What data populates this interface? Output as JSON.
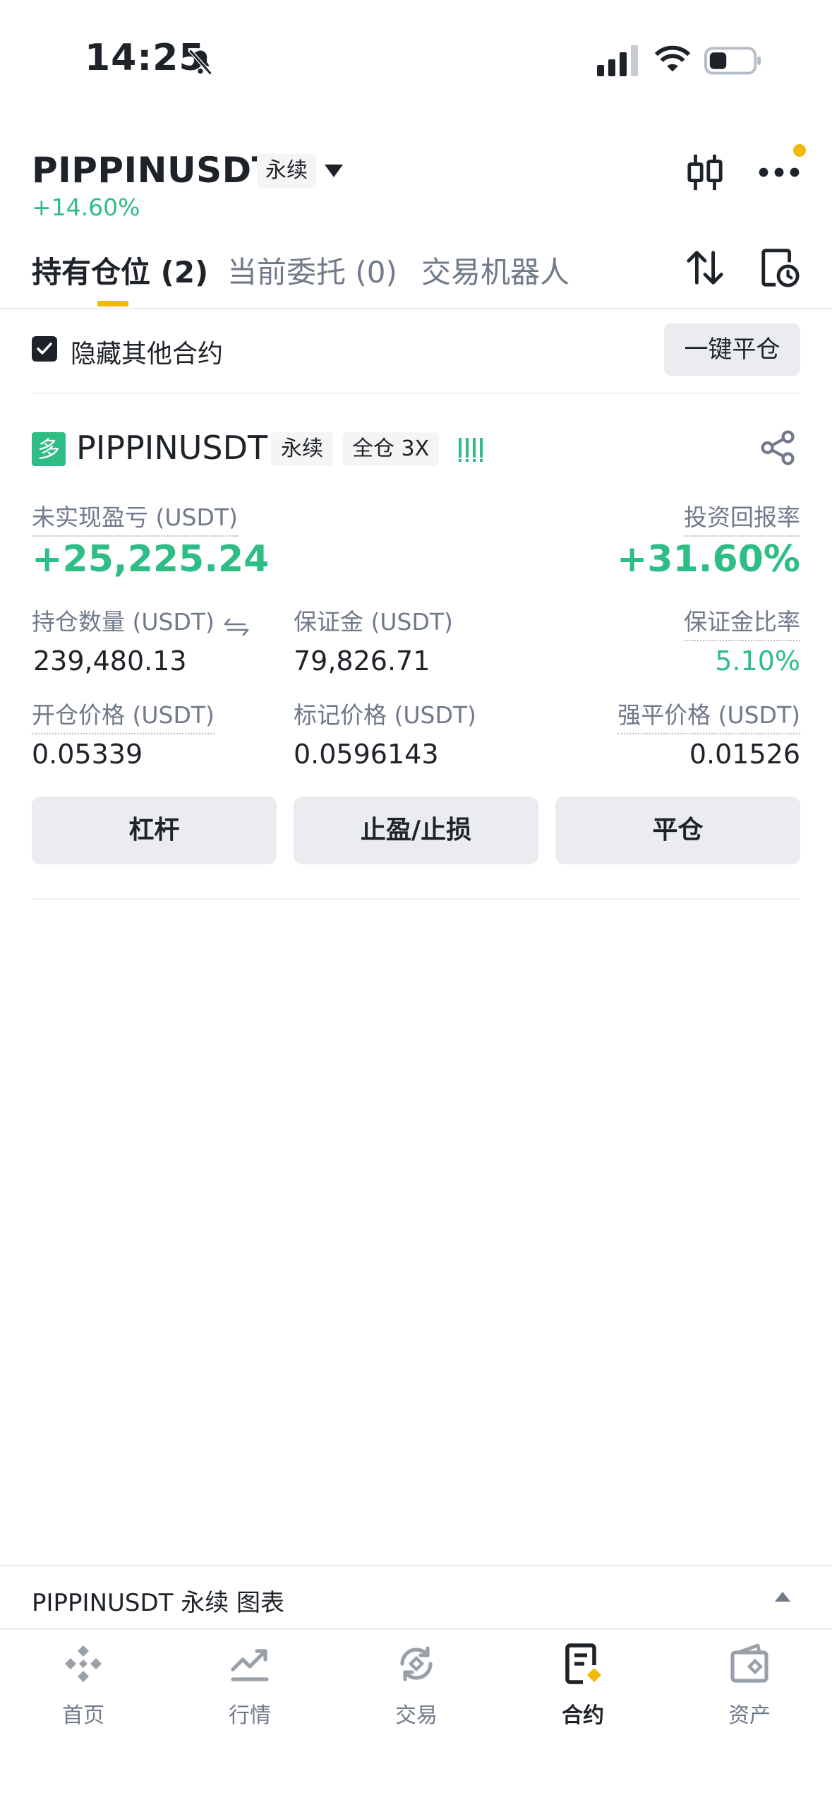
{
  "status_bar": {
    "time": "14:25"
  },
  "header": {
    "symbol": "PIPPINUSDT",
    "contract_type": "永续",
    "change": "+14.60%"
  },
  "tabs": [
    {
      "label": "持有仓位 (2)",
      "active": true
    },
    {
      "label": "当前委托 (0)",
      "active": false
    },
    {
      "label": "交易机器人",
      "active": false
    }
  ],
  "filter": {
    "hide_other_label": "隐藏其他合约",
    "hide_other_checked": true,
    "close_all_label": "一键平仓"
  },
  "position": {
    "side": "多",
    "symbol": "PIPPINUSDT",
    "contract_type": "永续",
    "margin_mode": "全仓 3X",
    "unrealized_pnl_label": "未实现盈亏 (USDT)",
    "unrealized_pnl": "+25,225.24",
    "roi_label": "投资回报率",
    "roi": "+31.60%",
    "size_label": "持仓数量 (USDT)",
    "size": "239,480.13",
    "margin_label": "保证金 (USDT)",
    "margin": "79,826.71",
    "margin_ratio_label": "保证金比率",
    "margin_ratio": "5.10%",
    "entry_label": "开仓价格 (USDT)",
    "entry": "0.05339",
    "mark_label": "标记价格 (USDT)",
    "mark": "0.0596143",
    "liq_label": "强平价格 (USDT)",
    "liq": "0.01526",
    "buttons": {
      "leverage": "杠杆",
      "tpsl": "止盈/止损",
      "close": "平仓"
    }
  },
  "chart_bar": {
    "title": "PIPPINUSDT 永续 图表"
  },
  "nav": [
    {
      "label": "首页",
      "icon": "home-icon",
      "active": false
    },
    {
      "label": "行情",
      "icon": "markets-icon",
      "active": false
    },
    {
      "label": "交易",
      "icon": "trade-icon",
      "active": false
    },
    {
      "label": "合约",
      "icon": "futures-icon",
      "active": true
    },
    {
      "label": "资产",
      "icon": "wallet-icon",
      "active": false
    }
  ],
  "colors": {
    "accent": "#f0b90b",
    "up": "#2ebd85",
    "text": "#1e2329",
    "muted": "#707a8a"
  }
}
